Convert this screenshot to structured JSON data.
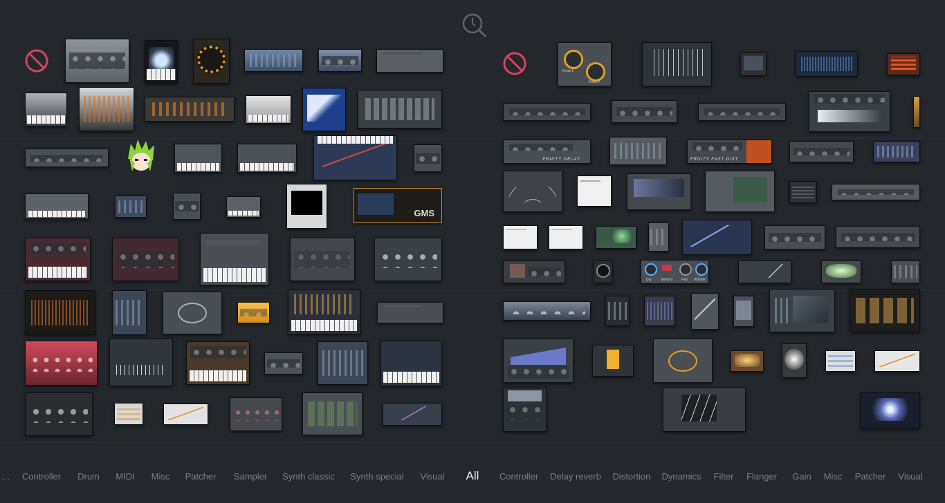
{
  "tabs": {
    "left": [
      "Controller",
      "Drum",
      "MIDI",
      "Misc",
      "Patcher",
      "Sampler",
      "Synth classic",
      "Synth special",
      "Visual"
    ],
    "center": "All",
    "right": [
      "Controller",
      "Delay reverb",
      "Distortion",
      "Dynamics",
      "Filter",
      "Flanger",
      "Gain",
      "Misc",
      "Patcher",
      "Visual"
    ]
  },
  "colors": {
    "background": "#24282d",
    "tab_text": "#7b8087",
    "tab_active": "#f2f2f2",
    "no_plugin_icon": "#d64560"
  },
  "icons": {
    "search": "magnifier-icon",
    "empty_slot": "no-entry-icon"
  },
  "thumb_texts": {
    "fruity_delay": "FRUITY DELAY",
    "fruity_fast_dist": "FRUITY FAST DIST",
    "gms": "GMS",
    "knob1": "Knob 1",
    "knob2": "Knob 2",
    "dry": "Dry",
    "send_to": "Send to",
    "pan": "Pan",
    "volume": "Volume"
  }
}
